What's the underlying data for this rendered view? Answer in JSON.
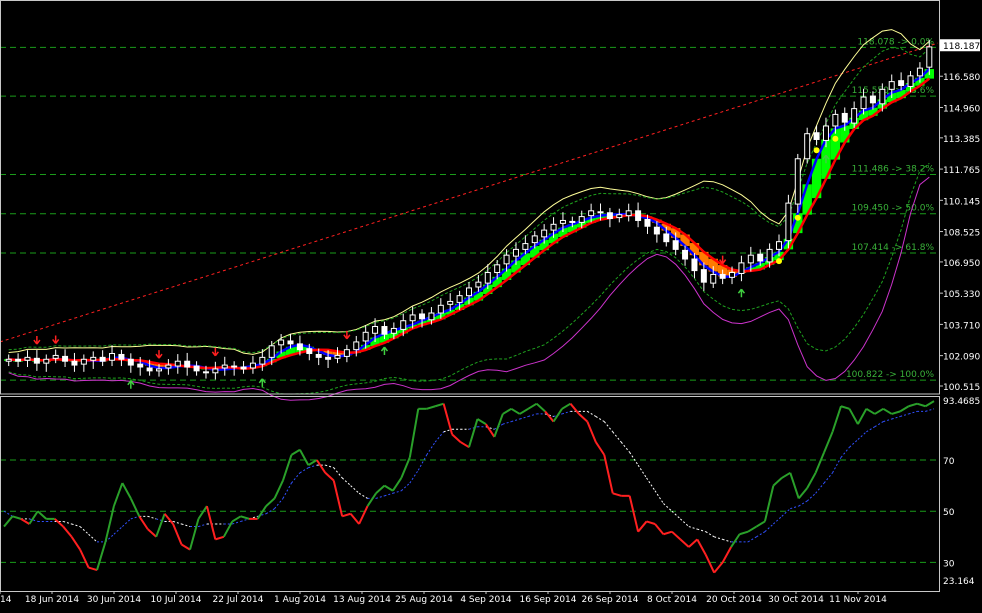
{
  "colors": {
    "background": "#000000",
    "frame": "#c8c8c8",
    "grid_fib": "#1a9c1a",
    "fib_text": "#39b139",
    "candle": "#ffffff",
    "bull_fill": "#00ff00",
    "bear_fill": "#000000",
    "ma_fast": "#0000ff",
    "ma_mid": "#ff0000",
    "bb_mid": "#ffff99",
    "bb_outer": "#1ea01e",
    "bb_low_magenta": "#cc33cc",
    "trendline": "#ff2020",
    "up_arrow": "#40d040",
    "down_arrow": "#ff2020",
    "yellow_dot": "#ffff00",
    "osc_green": "#2aa02a",
    "osc_red": "#ff2020",
    "osc_signal_blue": "#3050ff",
    "osc_signal_white": "#ffffff",
    "text": "#ffffff"
  },
  "chart_data": [
    {
      "type": "candlestick",
      "panel": "price",
      "y_ticks": [
        "118.187",
        "116.580",
        "114.960",
        "113.385",
        "111.765",
        "110.145",
        "108.525",
        "106.950",
        "105.330",
        "103.710",
        "102.090",
        "100.515"
      ],
      "ylim": [
        100.1,
        119.6
      ],
      "current_price": "118.187",
      "fib_levels": [
        {
          "label": "118.078 -> 0.0%",
          "value": 118.078
        },
        {
          "label": "115.550 -> 23.6%",
          "value": 115.55
        },
        {
          "label": "111.486 -> 38.2%",
          "value": 111.486
        },
        {
          "label": "109.450 -> 50.0%",
          "value": 109.45
        },
        {
          "label": "107.414 -> 61.8%",
          "value": 107.414
        },
        {
          "label": "100.822 -> 100.0%",
          "value": 100.822
        }
      ],
      "x_labels": [
        "14",
        "18 Jun 2014",
        "30 Jun 2014",
        "10 Jul 2014",
        "22 Jul 2014",
        "1 Aug 2014",
        "13 Aug 2014",
        "25 Aug 2014",
        "4 Sep 2014",
        "16 Sep 2014",
        "26 Sep 2014",
        "8 Oct 2014",
        "20 Oct 2014",
        "30 Oct 2014",
        "11 Nov 2014"
      ],
      "close": [
        101.9,
        101.8,
        102.0,
        101.7,
        101.9,
        102.1,
        101.8,
        101.6,
        101.9,
        102.0,
        101.8,
        102.2,
        101.9,
        101.6,
        101.5,
        101.3,
        101.4,
        101.6,
        101.8,
        101.5,
        101.3,
        101.2,
        101.4,
        101.6,
        101.5,
        101.4,
        101.7,
        102.0,
        102.6,
        102.9,
        102.7,
        102.4,
        102.2,
        102.0,
        101.9,
        102.1,
        102.4,
        102.8,
        103.3,
        103.6,
        103.2,
        103.5,
        103.9,
        104.2,
        104.0,
        104.3,
        104.7,
        104.9,
        105.2,
        105.6,
        105.9,
        106.4,
        106.8,
        107.3,
        107.6,
        107.9,
        108.3,
        108.6,
        108.9,
        109.1,
        109.0,
        109.3,
        109.6,
        109.5,
        109.2,
        109.4,
        109.6,
        109.1,
        108.8,
        108.4,
        108.0,
        107.6,
        107.1,
        106.5,
        105.9,
        106.3,
        106.1,
        106.4,
        106.9,
        107.3,
        107.0,
        107.6,
        108.0,
        110.0,
        112.3,
        113.6,
        113.3,
        114.0,
        114.6,
        114.2,
        114.9,
        115.5,
        115.2,
        115.9,
        116.3,
        116.1,
        116.6,
        117.0,
        118.1
      ],
      "up_arrow_bars": [
        13,
        27,
        40,
        78,
        87
      ],
      "down_arrow_bars": [
        3,
        5,
        16,
        22,
        36,
        76
      ],
      "yellow_dot_bars": [
        82,
        84,
        86,
        88
      ]
    },
    {
      "type": "line",
      "panel": "oscillator",
      "y_ticks": [
        "93.4685",
        "70",
        "50",
        "30",
        "23.164"
      ],
      "ylim": [
        20,
        95
      ],
      "levels": [
        70,
        50,
        30
      ],
      "series": [
        {
          "values": [
            44,
            48,
            47,
            45,
            50,
            47,
            47,
            44,
            40,
            35,
            28,
            27,
            38,
            52,
            61,
            55,
            48,
            43,
            40,
            49,
            45,
            37,
            35,
            47,
            52,
            39,
            40,
            46,
            48,
            47,
            47,
            52,
            55,
            62,
            72,
            74,
            68,
            70,
            65,
            62,
            48,
            49,
            45,
            52,
            57,
            60,
            58,
            63,
            71,
            90,
            90,
            91,
            92,
            80,
            77,
            75,
            86,
            84,
            79,
            88,
            90,
            88,
            90,
            92,
            89,
            85,
            90,
            92,
            88,
            85,
            77,
            72,
            57,
            56,
            56,
            42,
            46,
            45,
            41,
            42,
            39,
            36,
            39,
            33,
            26,
            30,
            36,
            41,
            42,
            44,
            46,
            60,
            63,
            65,
            55,
            59,
            65,
            73,
            81,
            91,
            90,
            84,
            90,
            88,
            90,
            88,
            89,
            91,
            92,
            91,
            93
          ]
        }
      ],
      "signal": [
        50,
        48,
        47,
        47,
        46,
        46,
        46,
        46,
        45,
        44,
        41,
        38,
        38,
        41,
        44,
        47,
        48,
        48,
        47,
        46,
        46,
        45,
        44,
        44,
        45,
        45,
        45,
        45,
        46,
        47,
        48,
        49,
        51,
        55,
        61,
        65,
        67,
        68,
        68,
        67,
        63,
        60,
        57,
        55,
        55,
        56,
        57,
        58,
        61,
        66,
        72,
        77,
        81,
        82,
        82,
        82,
        83,
        83,
        82,
        84,
        85,
        86,
        87,
        88,
        88,
        87,
        88,
        89,
        89,
        89,
        87,
        85,
        81,
        77,
        73,
        68,
        63,
        58,
        53,
        50,
        47,
        44,
        43,
        42,
        40,
        39,
        38,
        38,
        38,
        40,
        42,
        45,
        48,
        51,
        52,
        54,
        57,
        61,
        65,
        71,
        75,
        78,
        81,
        83,
        85,
        86,
        87,
        88,
        89,
        89,
        90
      ]
    }
  ]
}
